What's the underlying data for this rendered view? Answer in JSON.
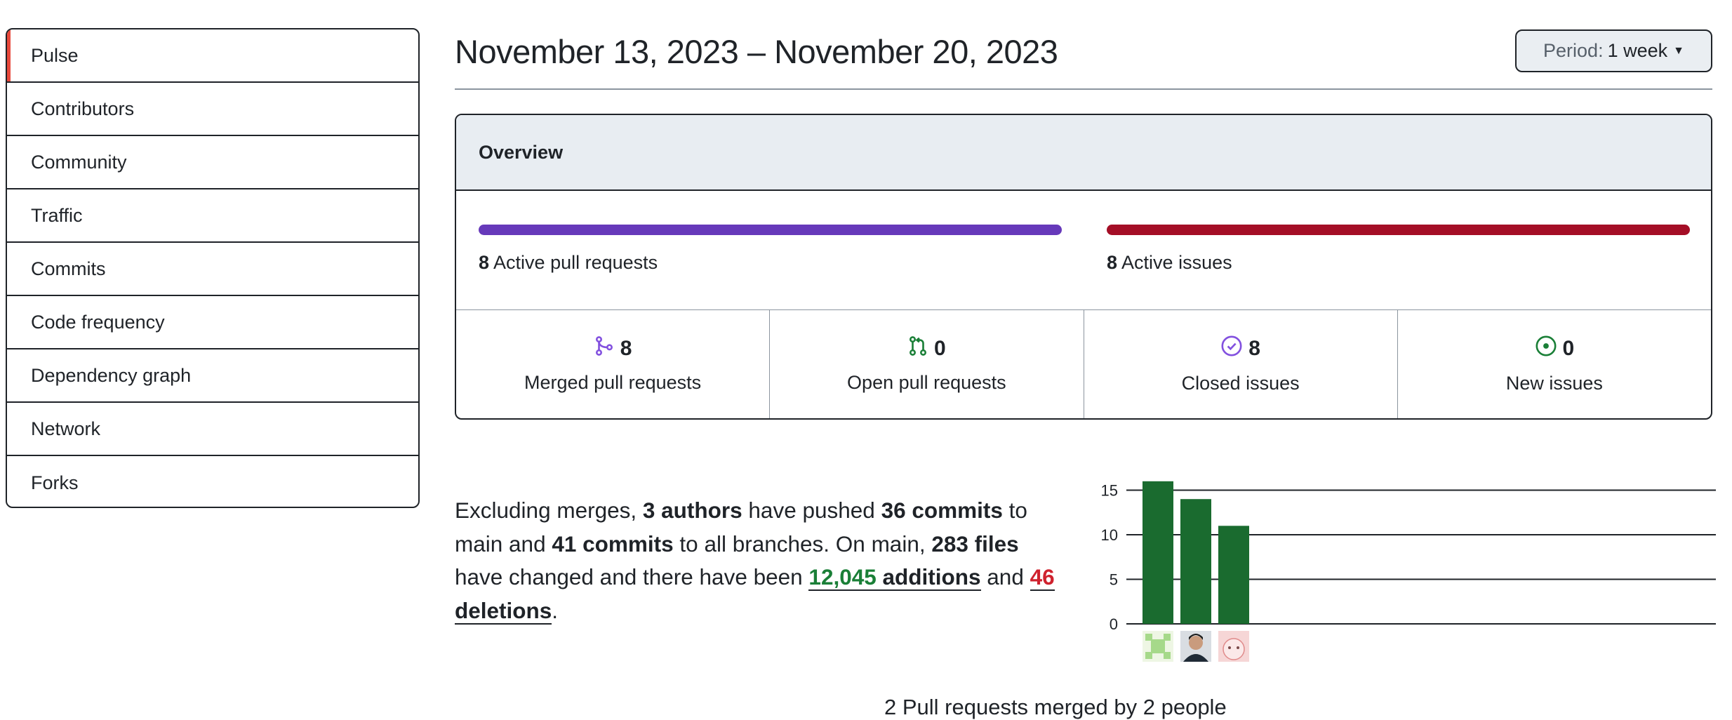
{
  "sidebar": {
    "items": [
      {
        "label": "Pulse",
        "selected": true
      },
      {
        "label": "Contributors"
      },
      {
        "label": "Community"
      },
      {
        "label": "Traffic"
      },
      {
        "label": "Commits"
      },
      {
        "label": "Code frequency"
      },
      {
        "label": "Dependency graph"
      },
      {
        "label": "Network"
      },
      {
        "label": "Forks"
      }
    ]
  },
  "header": {
    "date_range": "November 13, 2023 – November 20, 2023",
    "period_label": "Period:",
    "period_value": "1 week"
  },
  "overview": {
    "title": "Overview",
    "pull_requests": {
      "count": "8",
      "label": "Active pull requests",
      "fill_fraction": 1.0,
      "color": "#6639ba"
    },
    "issues": {
      "count": "8",
      "label": "Active issues",
      "fill_fraction": 1.0,
      "color": "#a40e26"
    },
    "stats": [
      {
        "icon": "git-merge-icon",
        "count": "8",
        "label": "Merged pull requests",
        "color": "#8250df"
      },
      {
        "icon": "git-pull-request-icon",
        "count": "0",
        "label": "Open pull requests",
        "color": "#1a7f37"
      },
      {
        "icon": "issue-closed-icon",
        "count": "8",
        "label": "Closed issues",
        "color": "#8250df"
      },
      {
        "icon": "issue-opened-icon",
        "count": "0",
        "label": "New issues",
        "color": "#1a7f37"
      }
    ]
  },
  "summary": {
    "t1": "Excluding merges, ",
    "authors": "3 authors",
    "t2": " have pushed ",
    "commits_main": "36 commits",
    "t3": " to main and ",
    "commits_all": "41 commits",
    "t4": " to all branches. On main, ",
    "files": "283 files",
    "t5": " have changed and there have been ",
    "additions_num": "12,045",
    "additions_word": " additions",
    "t6": " and ",
    "deletions_num": "46",
    "deletions_word": " deletions",
    "t7": "."
  },
  "chart_data": {
    "type": "bar",
    "categories": [
      "author-1",
      "author-2",
      "author-3"
    ],
    "values": [
      16,
      14,
      11
    ],
    "yticks": [
      0,
      5,
      10,
      15
    ],
    "ylim": [
      0,
      16
    ],
    "grid": true,
    "bar_color": "#1a6b2f",
    "avatars": [
      "identicon-avatar",
      "photo-avatar",
      "cartoon-avatar"
    ]
  },
  "footer_partial": "2 Pull requests merged by 2 people"
}
